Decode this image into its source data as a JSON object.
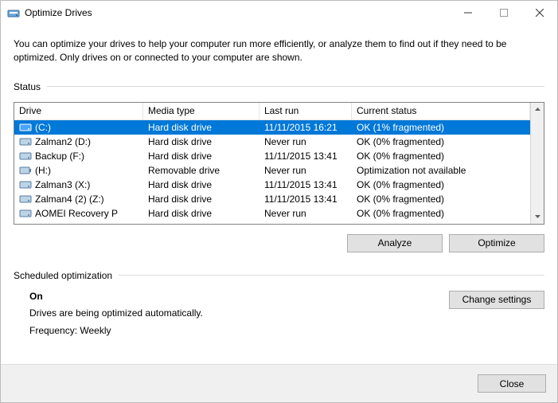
{
  "window": {
    "title": "Optimize Drives"
  },
  "intro": "You can optimize your drives to help your computer run more efficiently, or analyze them to find out if they need to be optimized. Only drives on or connected to your computer are shown.",
  "status_label": "Status",
  "columns": {
    "drive": "Drive",
    "media": "Media type",
    "last": "Last run",
    "status": "Current status"
  },
  "drives": [
    {
      "name": "(C:)",
      "media": "Hard disk drive",
      "last": "11/11/2015 16:21",
      "status": "OK (1% fragmented)",
      "selected": true,
      "icon": "hdd"
    },
    {
      "name": "Zalman2 (D:)",
      "media": "Hard disk drive",
      "last": "Never run",
      "status": "OK (0% fragmented)",
      "selected": false,
      "icon": "hdd"
    },
    {
      "name": "Backup (F:)",
      "media": "Hard disk drive",
      "last": "11/11/2015 13:41",
      "status": "OK (0% fragmented)",
      "selected": false,
      "icon": "hdd"
    },
    {
      "name": "(H:)",
      "media": "Removable drive",
      "last": "Never run",
      "status": "Optimization not available",
      "selected": false,
      "icon": "rem"
    },
    {
      "name": "Zalman3 (X:)",
      "media": "Hard disk drive",
      "last": "11/11/2015 13:41",
      "status": "OK (0% fragmented)",
      "selected": false,
      "icon": "hdd"
    },
    {
      "name": "Zalman4 (2) (Z:)",
      "media": "Hard disk drive",
      "last": "11/11/2015 13:41",
      "status": "OK (0% fragmented)",
      "selected": false,
      "icon": "hdd"
    },
    {
      "name": "AOMEI Recovery P",
      "media": "Hard disk drive",
      "last": "Never run",
      "status": "OK (0% fragmented)",
      "selected": false,
      "icon": "hdd"
    }
  ],
  "buttons": {
    "analyze": "Analyze",
    "optimize": "Optimize",
    "change": "Change settings",
    "close": "Close"
  },
  "sched": {
    "label": "Scheduled optimization",
    "state": "On",
    "line1": "Drives are being optimized automatically.",
    "line2": "Frequency: Weekly"
  }
}
